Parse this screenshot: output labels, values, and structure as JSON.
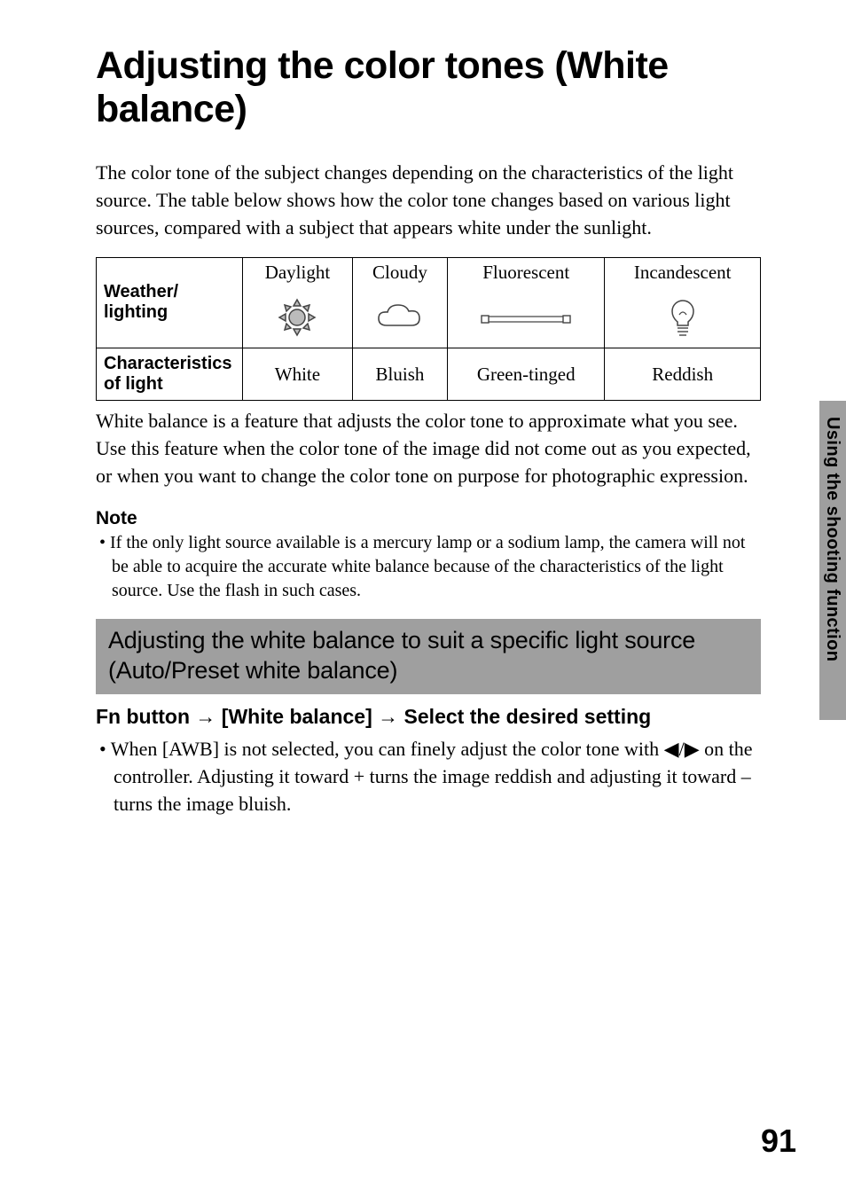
{
  "title": "Adjusting the color tones (White balance)",
  "intro": "The color tone of the subject changes depending on the characteristics of the light source. The table below shows how the color tone changes based on various light sources, compared with a subject that appears white under the sunlight.",
  "table": {
    "row1_label": "Weather/ lighting",
    "row2_label": "Characteristics of light",
    "cols": [
      "Daylight",
      "Cloudy",
      "Fluorescent",
      "Incandescent"
    ],
    "chars": [
      "White",
      "Bluish",
      "Green-tinged",
      "Reddish"
    ]
  },
  "para2": "White balance is a feature that adjusts the color tone to approximate what you see. Use this feature when the color tone of the image did not come out as you expected, or when you want to change the color tone on purpose for photographic expression.",
  "note_head": "Note",
  "note_bullet": "• If the only light source available is a mercury lamp or a sodium lamp, the camera will not be able to acquire the accurate white balance because of the characteristics of the light source. Use the flash in such cases.",
  "sub_head": "Adjusting the white balance to suit a specific light source (Auto/Preset white balance)",
  "fn_parts": {
    "a": "Fn button ",
    "arrow": "→",
    "b": " [White balance] ",
    "c": " Select the desired setting"
  },
  "main_bullet_parts": {
    "a": "• When [AWB] is not selected, you can finely adjust the color tone with ",
    "left": "◀",
    "slash": "/",
    "right": "▶",
    "b": " on the controller. Adjusting it toward + turns the image reddish and adjusting it toward – turns the image bluish."
  },
  "side_text": "Using the shooting function",
  "page_number": "91"
}
